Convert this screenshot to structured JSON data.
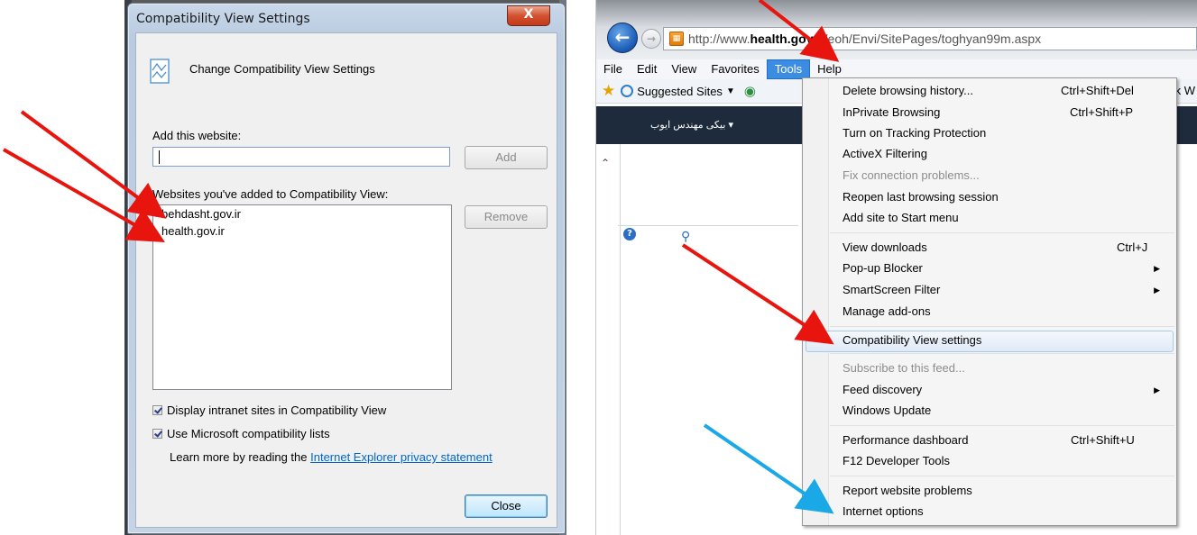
{
  "dialog": {
    "title": "Compatibility View Settings",
    "close_glyph": "X",
    "header": "Change Compatibility View Settings",
    "add_label": "Add this website:",
    "input_value": "",
    "add_button": "Add",
    "list_label": "Websites you've added to Compatibility View:",
    "sites": [
      "behdasht.gov.ir",
      "health.gov.ir"
    ],
    "remove_button": "Remove",
    "check1": "Display intranet sites in Compatibility View",
    "check2": "Use Microsoft compatibility lists",
    "learn_prefix": "Learn more by reading the",
    "learn_link": "Internet Explorer privacy statement",
    "close_button": "Close"
  },
  "browser": {
    "back_glyph": "←",
    "forward_glyph": "→",
    "url_pre": "http://www.",
    "url_bold": "health.gov.ir",
    "url_post": "/eoh/Envi/SitePages/toghyan99m.aspx",
    "menubar": [
      "File",
      "Edit",
      "View",
      "Favorites",
      "Tools",
      "Help"
    ],
    "favbar_item": "Suggested Sites",
    "favbar_end": "k W",
    "site_user": "بیکی مهندس ایوب",
    "tools_menu": {
      "delete_history": "Delete browsing history...",
      "delete_history_sc": "Ctrl+Shift+Del",
      "inprivate": "InPrivate Browsing",
      "inprivate_sc": "Ctrl+Shift+P",
      "tracking": "Turn on Tracking Protection",
      "activex": "ActiveX Filtering",
      "fix_connection": "Fix connection problems...",
      "reopen": "Reopen last browsing session",
      "add_start": "Add site to Start menu",
      "view_downloads": "View downloads",
      "view_downloads_sc": "Ctrl+J",
      "popup": "Pop-up Blocker",
      "smartscreen": "SmartScreen Filter",
      "addons": "Manage add-ons",
      "compat": "Compatibility View settings",
      "subscribe": "Subscribe to this feed...",
      "feed": "Feed discovery",
      "winupdate": "Windows Update",
      "perf": "Performance dashboard",
      "perf_sc": "Ctrl+Shift+U",
      "f12": "F12 Developer Tools",
      "report": "Report website problems",
      "options": "Internet options",
      "submenu_glyph": "▶"
    }
  },
  "colors": {
    "annotation_red": "#e8150f",
    "annotation_blue": "#1aa8e6",
    "highlight": "#3c8ce1"
  }
}
